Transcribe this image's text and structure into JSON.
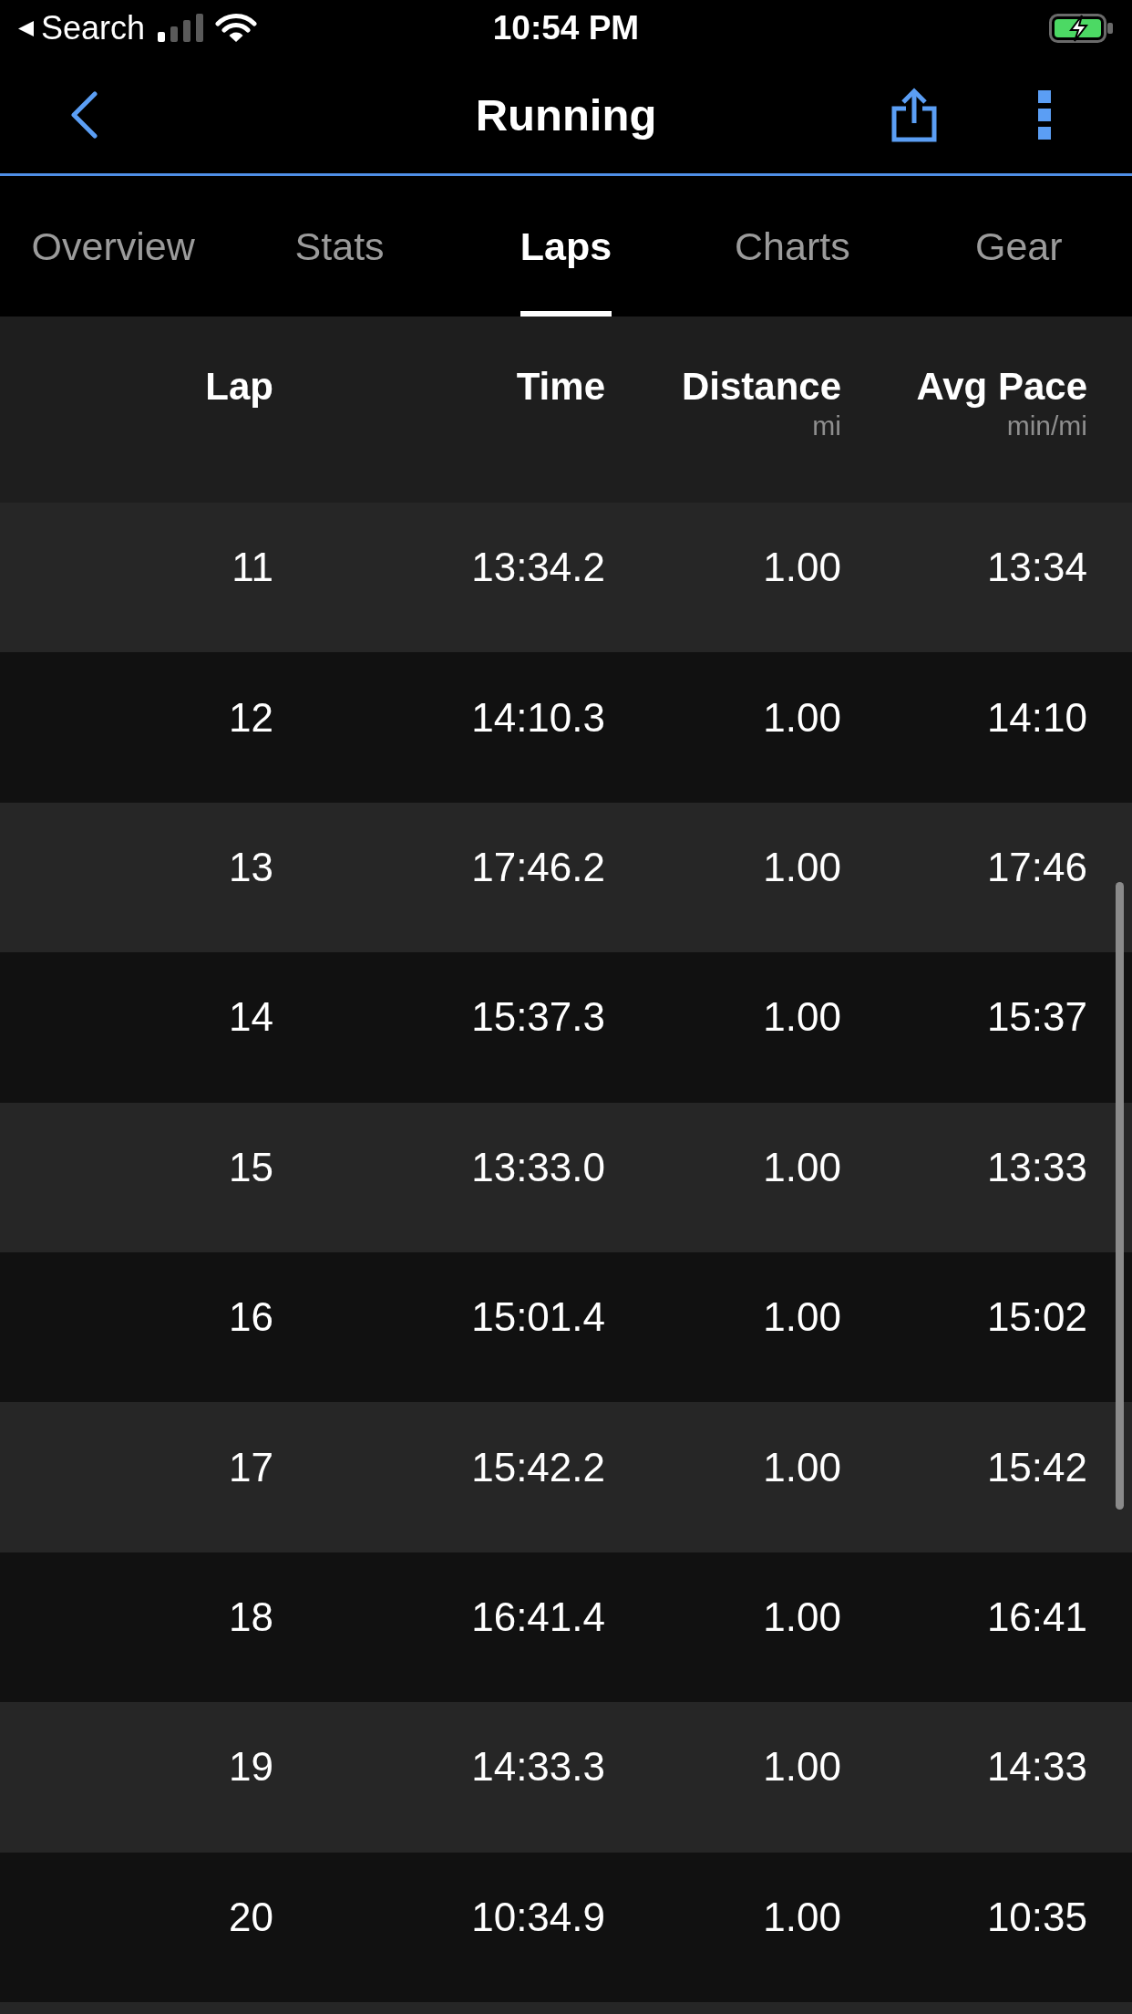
{
  "status_bar": {
    "back_label": "Search",
    "time": "10:54 PM"
  },
  "nav_bar": {
    "title": "Running"
  },
  "tabs": [
    {
      "label": "Overview",
      "selected": false
    },
    {
      "label": "Stats",
      "selected": false
    },
    {
      "label": "Laps",
      "selected": true
    },
    {
      "label": "Charts",
      "selected": false
    },
    {
      "label": "Gear",
      "selected": false
    }
  ],
  "table": {
    "columns": [
      {
        "label": "Lap"
      },
      {
        "label": "Time"
      },
      {
        "label": "Distance",
        "unit": "mi"
      },
      {
        "label": "Avg Pace",
        "unit": "min/mi"
      }
    ],
    "rows": [
      [
        "11",
        "13:34.2",
        "1.00",
        "13:34"
      ],
      [
        "12",
        "14:10.3",
        "1.00",
        "14:10"
      ],
      [
        "13",
        "17:46.2",
        "1.00",
        "17:46"
      ],
      [
        "14",
        "15:37.3",
        "1.00",
        "15:37"
      ],
      [
        "15",
        "13:33.0",
        "1.00",
        "13:33"
      ],
      [
        "16",
        "15:01.4",
        "1.00",
        "15:02"
      ],
      [
        "17",
        "15:42.2",
        "1.00",
        "15:42"
      ],
      [
        "18",
        "16:41.4",
        "1.00",
        "16:41"
      ],
      [
        "19",
        "14:33.3",
        "1.00",
        "14:33"
      ],
      [
        "20",
        "10:34.9",
        "1.00",
        "10:35"
      ]
    ]
  }
}
